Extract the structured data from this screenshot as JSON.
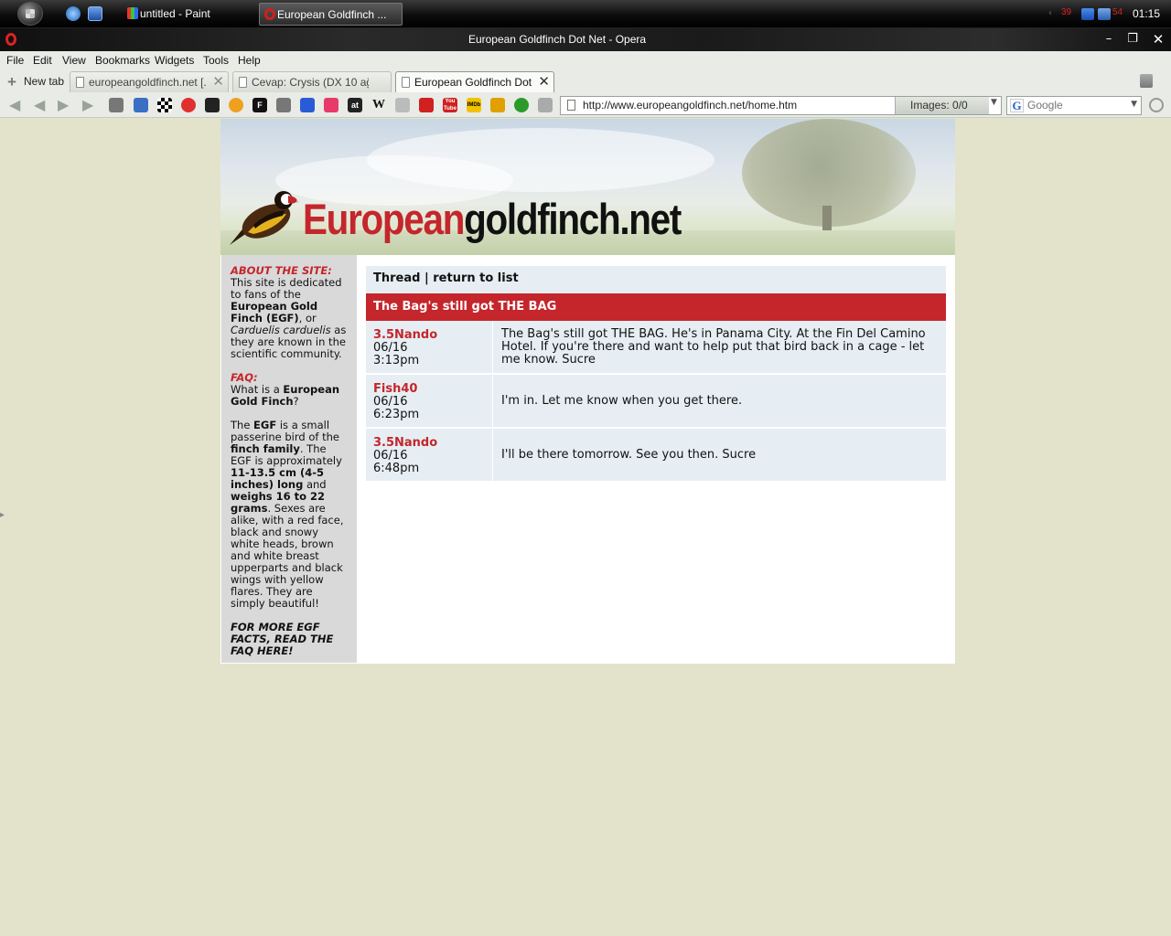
{
  "taskbar": {
    "tasks": [
      {
        "label": "untitled - Paint"
      },
      {
        "label": "European Goldfinch ..."
      }
    ],
    "tray": {
      "net1": "39",
      "net2": "54"
    },
    "clock": "01:15"
  },
  "window": {
    "title": "European Goldfinch Dot Net - Opera"
  },
  "menu": [
    "File",
    "Edit",
    "View",
    "Bookmarks",
    "Widgets",
    "Tools",
    "Help"
  ],
  "tabs": {
    "new_tab_label": "New tab",
    "items": [
      {
        "label": "europeangoldfinch.net [..."
      },
      {
        "label": "Cevap: Crysis (DX 10 ağ..."
      },
      {
        "label": "European Goldfinch Dot ..."
      }
    ]
  },
  "toolbar": {
    "address": "http://www.europeangoldfinch.net/home.htm",
    "images_label": "Images:",
    "images_value": "0/0",
    "search_placeholder": "Google",
    "bookmark_icons": [
      "F",
      "W",
      "at",
      "You Tube",
      "IMDb"
    ]
  },
  "site": {
    "logo_red": "European",
    "logo_black": "goldfinch.net",
    "accent_color": "#c4262c"
  },
  "sidebar": {
    "about_head": "ABOUT THE SITE:",
    "about_1": "This site is dedicated to fans of the ",
    "about_2": "European Gold Finch (EGF)",
    "about_3": ", or ",
    "about_4": "Carduelis carduelis",
    "about_5": " as they are known in the scientific community.",
    "faq_head": "FAQ:",
    "faq_q1": "What is a ",
    "faq_q2": "European Gold Finch",
    "faq_q3": "?",
    "faq_a1": "The ",
    "faq_a2": "EGF",
    "faq_a3": " is a small passerine bird of the ",
    "faq_a4": "finch family",
    "faq_a5": ". The EGF is approximately ",
    "faq_a6": "11-13.5 cm (4-5 inches) long",
    "faq_a7": " and ",
    "faq_a8": "weighs 16 to 22 grams",
    "faq_a9": ". Sexes are alike, with a red face, black and snowy white heads, brown and white breast upperparts and black wings with yellow flares. They are simply beautiful!",
    "more": "FOR MORE EGF FACTS, READ THE FAQ HERE!"
  },
  "thread": {
    "header_thread": "Thread",
    "header_sep": " | ",
    "header_return": "return to list",
    "title": "The Bag's still got THE BAG",
    "posts": [
      {
        "author": "3.5Nando",
        "date": "06/16",
        "time": "3:13pm",
        "body": "The Bag's still got THE BAG. He's in Panama City. At the Fin Del Camino Hotel. If you're there and want to help put that bird back in a cage - let me know. Sucre"
      },
      {
        "author": "Fish40",
        "date": "06/16",
        "time": "6:23pm",
        "body": "I'm in. Let me know when you get there."
      },
      {
        "author": "3.5Nando",
        "date": "06/16",
        "time": "6:48pm",
        "body": "I'll be there tomorrow. See you then. Sucre"
      }
    ]
  }
}
